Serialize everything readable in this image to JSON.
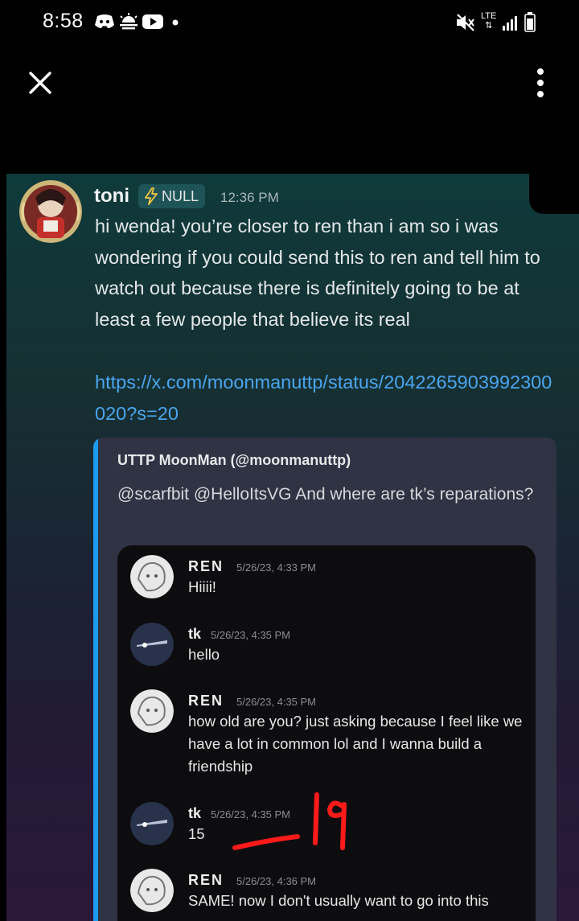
{
  "status_bar": {
    "time": "8:58",
    "network": "LTE",
    "icons": [
      "discord-icon",
      "weather-icon",
      "youtube-icon",
      "dot-icon",
      "mute-icon",
      "lte-icon",
      "signal-icon",
      "battery-icon"
    ]
  },
  "toolbar": {
    "close_icon": "close-icon",
    "more_icon": "more-vertical-icon"
  },
  "message": {
    "username": "toni",
    "tag": "NULL",
    "time": "12:36 PM",
    "text": "hi wenda! you’re closer to ren than i am so i was wondering if you could send this to ren and tell him to watch out because there is definitely going to be at least a few people that believe its real",
    "link": "https://x.com/moonmanuttp/status/2042265903992300020?s=20"
  },
  "embed": {
    "author": "UTTP MoonMan (@moonmanuttp)",
    "description": "@scarfbit @HelloItsVG And where are tk’s reparations?",
    "accent_color": "#1d9bf0",
    "chat": [
      {
        "name": "REN",
        "time": "5/26/23, 4:33 PM",
        "text": "Hiiii!"
      },
      {
        "name": "tk",
        "time": "5/26/23, 4:35 PM",
        "text": "hello"
      },
      {
        "name": "REN",
        "time": "5/26/23, 4:35 PM",
        "text": "how old are you? just asking because I feel like we have a lot in common lol and I wanna build a friendship"
      },
      {
        "name": "tk",
        "time": "5/26/23, 4:35 PM",
        "text": "15"
      },
      {
        "name": "REN",
        "time": "5/26/23, 4:36 PM",
        "text": "SAME! now I don't usually want to go into this"
      }
    ],
    "annotation": "19"
  }
}
